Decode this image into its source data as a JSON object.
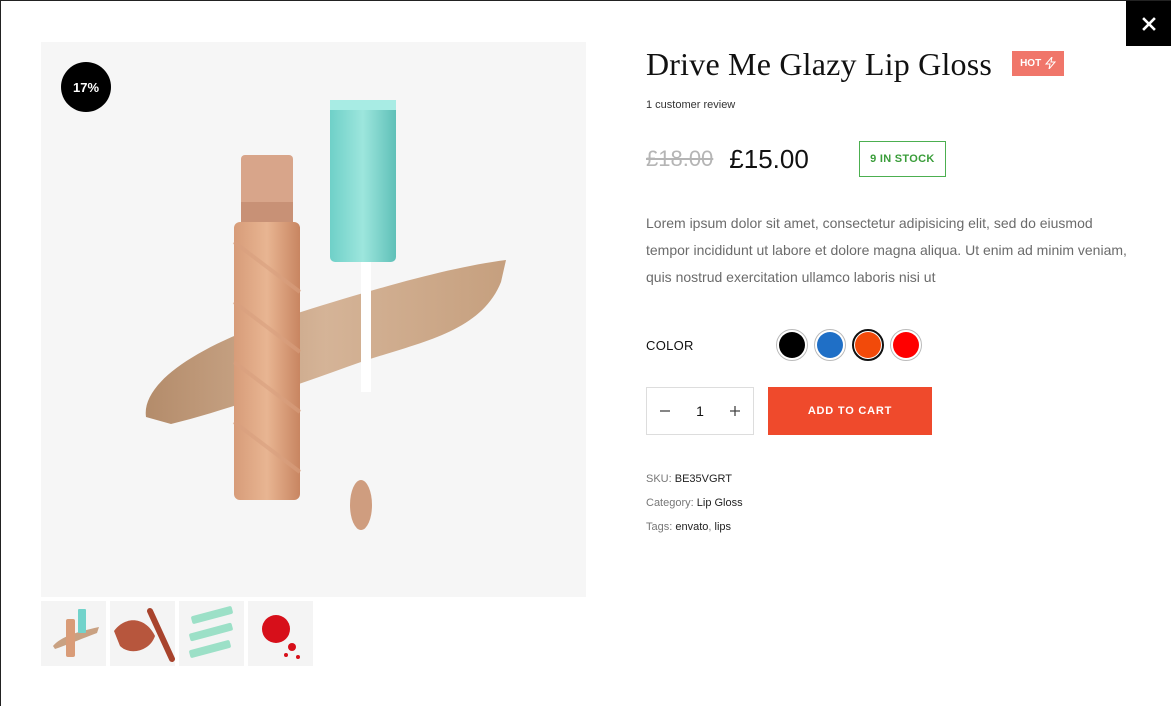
{
  "close": {
    "label": "×"
  },
  "gallery": {
    "sale_badge": "17%",
    "thumbnails": [
      "lip-gloss-thumb",
      "lip-swatch-thumb",
      "green-tubes-thumb",
      "red-drops-thumb"
    ]
  },
  "product": {
    "title": "Drive Me Glazy Lip Gloss",
    "hot_badge": "HOT",
    "review": "1 customer review",
    "old_price": "£18.00",
    "price": "£15.00",
    "stock": "9 IN STOCK",
    "description": "Lorem ipsum dolor sit amet, consectetur adipisicing elit, sed do eiusmod tempor incididunt ut labore et dolore magna aliqua. Ut enim ad minim veniam, quis nostrud exercitation ullamco laboris nisi ut",
    "color_label": "COLOR",
    "colors": [
      {
        "name": "black",
        "hex": "#000000"
      },
      {
        "name": "blue",
        "hex": "#1f6fc6"
      },
      {
        "name": "orange",
        "hex": "#f24a0a",
        "selected": true
      },
      {
        "name": "red",
        "hex": "#ff0000"
      }
    ],
    "quantity": "1",
    "add_to_cart": "ADD TO CART",
    "sku_label": "SKU:",
    "sku": "BE35VGRT",
    "category_label": "Category:",
    "category": "Lip Gloss",
    "tags_label": "Tags:",
    "tags": [
      "envato",
      "lips"
    ]
  },
  "colors": {
    "accent": "#ef4a2c",
    "hot": "#f0766a",
    "stock": "#3a9d3a"
  }
}
